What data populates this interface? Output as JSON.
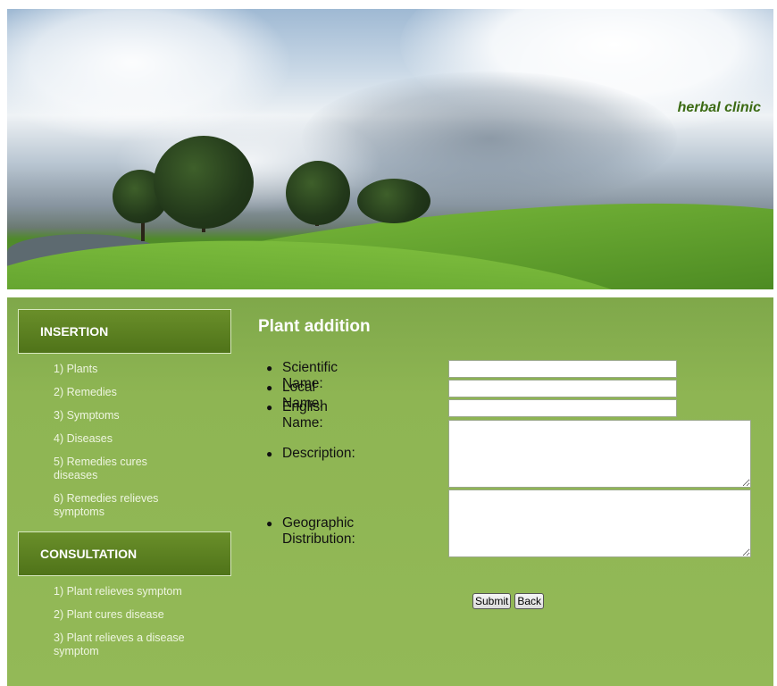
{
  "header": {
    "brand": "herbal clinic"
  },
  "sidebar": {
    "insertion": {
      "title": "INSERTION",
      "items": [
        {
          "label": "1) Plants"
        },
        {
          "label": "2) Remedies"
        },
        {
          "label": "3) Symptoms"
        },
        {
          "label": "4) Diseases"
        },
        {
          "label": "5) Remedies cures diseases"
        },
        {
          "label": "6) Remedies relieves symptoms"
        }
      ]
    },
    "consultation": {
      "title": "CONSULTATION",
      "items": [
        {
          "label": "1) Plant relieves symptom"
        },
        {
          "label": "2) Plant cures disease"
        },
        {
          "label": "3) Plant relieves a disease symptom"
        }
      ]
    }
  },
  "main": {
    "title": "Plant addition",
    "fields": {
      "scientific_name": {
        "label": "Scientific Name:",
        "value": ""
      },
      "local_name": {
        "label": "Local Name:",
        "value": ""
      },
      "english_name": {
        "label": "English Name:",
        "value": ""
      },
      "description": {
        "label": "Description:",
        "value": ""
      },
      "geographic_distribution": {
        "label": "Geographic Distribution:",
        "value": ""
      }
    },
    "buttons": {
      "submit": "Submit",
      "back": "Back"
    }
  },
  "colors": {
    "background_green": "#8eb553",
    "section_header": "#5a7f20",
    "brand_text": "#3b6a12"
  }
}
